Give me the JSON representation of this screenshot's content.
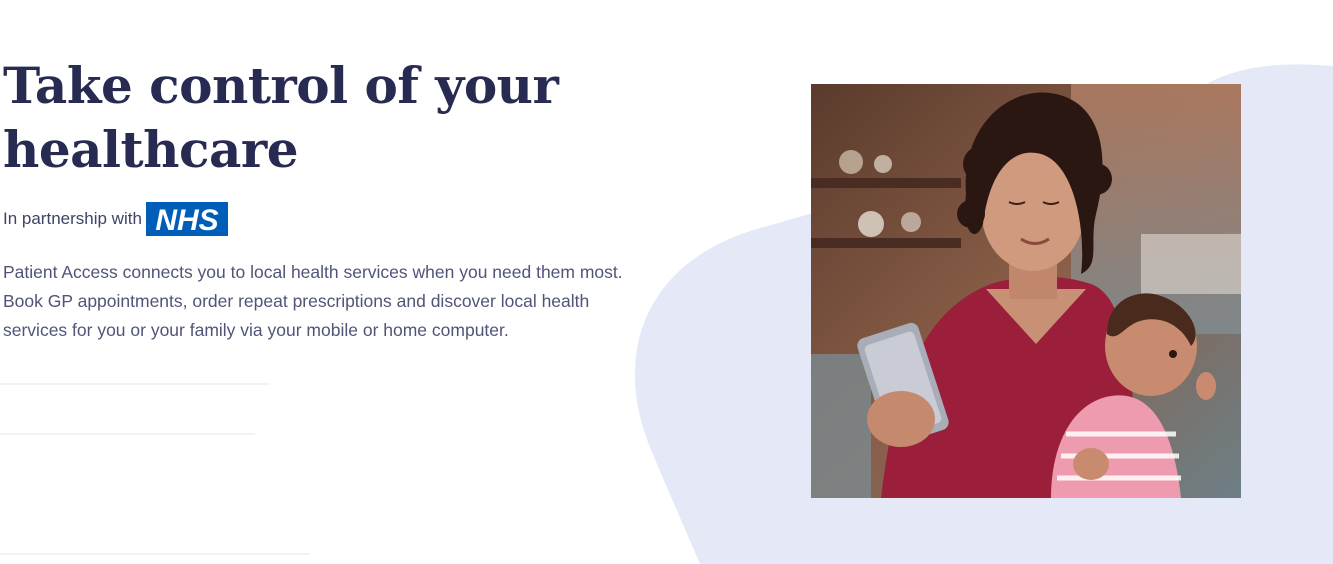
{
  "hero": {
    "title": "Take control of your healthcare",
    "partnership_prefix": "In partnership with",
    "partner_logo_text": "NHS",
    "description": "Patient Access connects you to local health services when you need them most. Book GP appointments, order repeat prescriptions and discover local health services for you or your family via your mobile or home computer."
  },
  "colors": {
    "title": "#272b52",
    "body_text": "#505578",
    "nhs_blue": "#005eb8",
    "blob": "#e5e8f6"
  }
}
